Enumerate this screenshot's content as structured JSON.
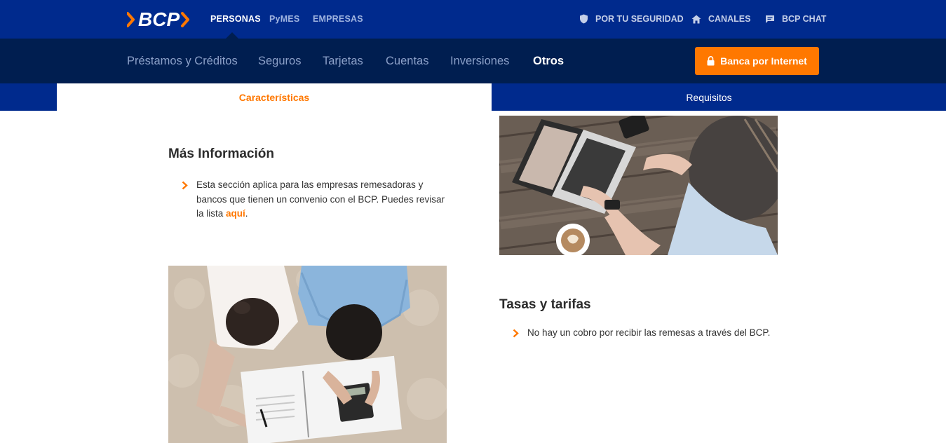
{
  "header": {
    "logo_text": "BCP",
    "segments": [
      {
        "label": "PERSONAS",
        "active": true
      },
      {
        "label": "PyMES",
        "active": false
      },
      {
        "label": "EMPRESAS",
        "active": false
      }
    ],
    "utility_links": [
      {
        "label": "POR TU SEGURIDAD",
        "icon": "shield-icon"
      },
      {
        "label": "CANALES",
        "icon": "home-icon"
      },
      {
        "label": "BCP CHAT",
        "icon": "chat-icon"
      }
    ]
  },
  "nav": {
    "items": [
      {
        "label": "Préstamos y Créditos"
      },
      {
        "label": "Seguros"
      },
      {
        "label": "Tarjetas"
      },
      {
        "label": "Cuentas"
      },
      {
        "label": "Inversiones"
      },
      {
        "label": "Otros",
        "active": true
      }
    ],
    "cta_label": "Banca por Internet",
    "cta_icon": "lock-icon"
  },
  "tabs": {
    "characteristics": "Características",
    "requirements": "Requisitos"
  },
  "sections": {
    "more_info": {
      "title": "Más Información",
      "text": "Esta sección aplica para las empresas remesadoras y bancos que tienen un convenio con el BCP.  Puedes revisar la lista ",
      "link": "aquí",
      "text_end": "."
    },
    "rates": {
      "title": "Tasas y tarifas",
      "text": "No hay un cobro por recibir las remesas a través del BCP."
    }
  },
  "colors": {
    "brand_blue": "#002a8d",
    "dark_navy": "#001e50",
    "accent_orange": "#ff7800"
  }
}
